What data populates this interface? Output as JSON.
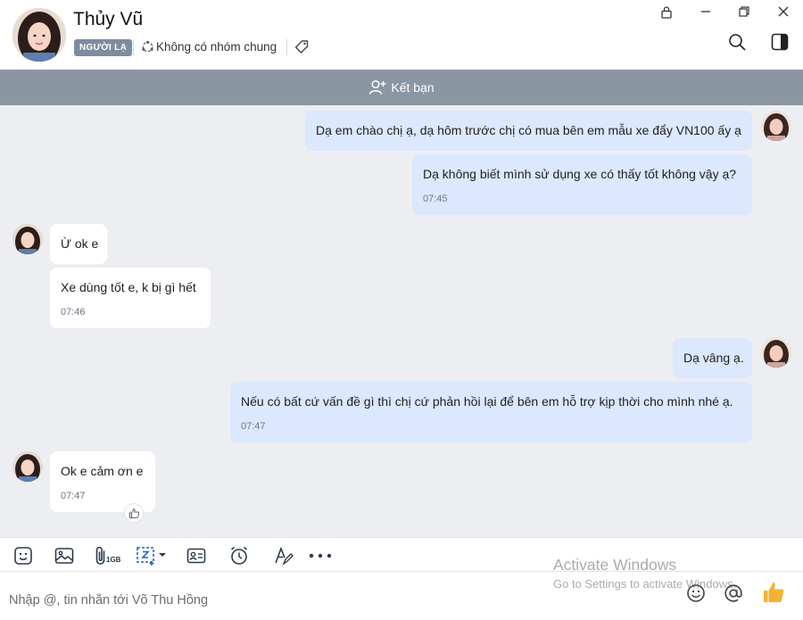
{
  "header": {
    "name": "Thủy Vũ",
    "badge": "NGƯỜI LẠ",
    "group_status": "Không có nhóm chung"
  },
  "friend_bar": {
    "label": "Kết bạn"
  },
  "messages": [
    {
      "text": "Dạ em chào chị ạ, dạ hôm trước chị có mua bên em mẫu xe đẩy VN100 ấy ạ"
    },
    {
      "text": "Dạ không biết mình sử dụng xe có thấy tốt không vậy ạ?",
      "time": "07:45"
    },
    {
      "text": "Ừ ok e"
    },
    {
      "text": "Xe dùng tốt e, k bị gì hết",
      "time": "07:46"
    },
    {
      "text": "Dạ vâng ạ."
    },
    {
      "text": "Nếu có bất cứ vấn đề gì thì chị cứ phản hồi lại để bên em hỗ trợ kịp thời cho mình nhé ạ.",
      "time": "07:47"
    },
    {
      "text": "Ok e  cảm ơn e",
      "time": "07:47"
    }
  ],
  "toolbar": {
    "file_size_label": "1GB"
  },
  "composer": {
    "placeholder": "Nhập @, tin nhắn tới Võ Thu Hồng"
  },
  "watermark": {
    "line1": "Activate Windows",
    "line2": "Go to Settings to activate Windows."
  },
  "colors": {
    "friend_bar": "#8b96a3",
    "outgoing_bubble": "#dbe8fd",
    "incoming_bubble": "#ffffff",
    "chat_background": "#eceef1",
    "like_thumb": "#f4b233"
  }
}
